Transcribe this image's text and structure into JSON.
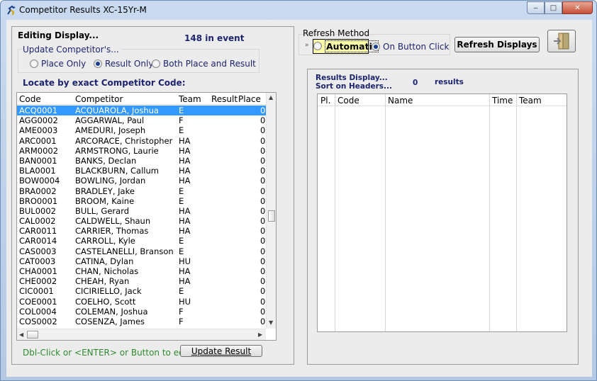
{
  "window": {
    "title": "Competitor Results XC-15Yr-M",
    "buttons": {
      "minimize": "‒",
      "maximize": "□",
      "close": "✕"
    }
  },
  "editing": {
    "title": "Editing Display...",
    "event_count": "148  in event",
    "update_label": "Update Competitor's...",
    "options": [
      "Place Only",
      "Result Only",
      "Both Place and Result"
    ],
    "selected_option": "Result Only",
    "locate_label": "Locate by exact Competitor Code:"
  },
  "competitor_list": {
    "headers": [
      "Code",
      "Competitor",
      "Team",
      "Result",
      "Place"
    ],
    "rows": [
      {
        "code": "ACQ0001",
        "name": "ACQUAROLA, Joshua",
        "team": "E",
        "result": "",
        "place": "0"
      },
      {
        "code": "AGG0002",
        "name": "AGGARWAL, Paul",
        "team": "F",
        "result": "",
        "place": "0"
      },
      {
        "code": "AME0003",
        "name": "AMEDURI, Joseph",
        "team": "E",
        "result": "",
        "place": "0"
      },
      {
        "code": "ARC0001",
        "name": "ARCORACE, Christopher",
        "team": "HA",
        "result": "",
        "place": "0"
      },
      {
        "code": "ARM0002",
        "name": "ARMSTRONG, Laurie",
        "team": "HA",
        "result": "",
        "place": "0"
      },
      {
        "code": "BAN0001",
        "name": "BANKS, Declan",
        "team": "HA",
        "result": "",
        "place": "0"
      },
      {
        "code": "BLA0001",
        "name": "BLACKBURN, Callum",
        "team": "HA",
        "result": "",
        "place": "0"
      },
      {
        "code": "BOW0004",
        "name": "BOWLING, Jordan",
        "team": "HA",
        "result": "",
        "place": "0"
      },
      {
        "code": "BRA0002",
        "name": "BRADLEY, Jake",
        "team": "E",
        "result": "",
        "place": "0"
      },
      {
        "code": "BRO0001",
        "name": "BROOM, Kaine",
        "team": "E",
        "result": "",
        "place": "0"
      },
      {
        "code": "BUL0002",
        "name": "BULL, Gerard",
        "team": "HA",
        "result": "",
        "place": "0"
      },
      {
        "code": "CAL0002",
        "name": "CALDWELL, Shaun",
        "team": "HA",
        "result": "",
        "place": "0"
      },
      {
        "code": "CAR0011",
        "name": "CARRIER, Thomas",
        "team": "HA",
        "result": "",
        "place": "0"
      },
      {
        "code": "CAR0014",
        "name": "CARROLL, Kyle",
        "team": "E",
        "result": "",
        "place": "0"
      },
      {
        "code": "CAS0003",
        "name": "CASTELANELLI, Branson",
        "team": "E",
        "result": "",
        "place": "0"
      },
      {
        "code": "CAT0003",
        "name": "CATINA, Dylan",
        "team": "HU",
        "result": "",
        "place": "0"
      },
      {
        "code": "CHA0001",
        "name": "CHAN, Nicholas",
        "team": "HA",
        "result": "",
        "place": "0"
      },
      {
        "code": "CHE0002",
        "name": "CHEAH, Ryan",
        "team": "HA",
        "result": "",
        "place": "0"
      },
      {
        "code": "CIC0001",
        "name": "CICIRIELLO, Jack",
        "team": "E",
        "result": "",
        "place": "0"
      },
      {
        "code": "COE0001",
        "name": "COELHO, Scott",
        "team": "HU",
        "result": "",
        "place": "0"
      },
      {
        "code": "COL0004",
        "name": "COLEMAN, Joshua",
        "team": "F",
        "result": "",
        "place": "0"
      },
      {
        "code": "COS0002",
        "name": "COSENZA, James",
        "team": "F",
        "result": "",
        "place": "0"
      }
    ],
    "selected_index": 0
  },
  "hint": "Dbl-Click or <ENTER> or Button to edit",
  "update_button": "Update Result",
  "refresh": {
    "label": "Refresh Method",
    "automatic": "Automatic",
    "on_button_click": "On Button Click",
    "selected": "On Button Click",
    "refresh_button": "Refresh Displays"
  },
  "results": {
    "title": "Results Display...",
    "sort_hint": "Sort on Headers...",
    "count": "0",
    "count_label": "results",
    "headers": [
      "Pl.",
      "Code",
      "Name",
      "Time",
      "Team"
    ]
  },
  "colors": {
    "accent_text": "#1d2470",
    "selection": "#3399ff",
    "hint_green": "#2e8b2e",
    "highlight_yellow": "#ffffa8"
  }
}
